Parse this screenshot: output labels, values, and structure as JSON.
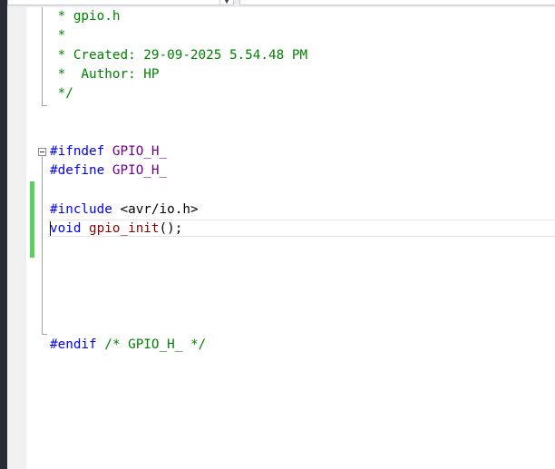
{
  "editor": {
    "header_comment": {
      "l1": " * gpio.h",
      "l2": " *",
      "l3": " * Created: 29-09-2025 5.54.48 PM",
      "l4": " *  Author: HP",
      "l5": " */"
    },
    "ifndef": {
      "directive": "#ifndef",
      "macro": "GPIO_H_"
    },
    "define": {
      "directive": "#define",
      "macro": "GPIO_H_"
    },
    "include": {
      "directive": "#include",
      "path": "<avr/io.h>"
    },
    "declaration": {
      "keyword": "void",
      "name": "gpio_init",
      "rest": "();"
    },
    "endif": {
      "directive": "#endif",
      "comment": "/* GPIO_H_ */"
    }
  },
  "colors": {
    "comment": "#008000",
    "preprocessor": "#0000ff",
    "macro": "#6f008a",
    "keyword": "#0000ff",
    "function": "#880000",
    "change_marker": "#57d35c"
  },
  "icons": {
    "collapse": "minus-box-icon",
    "dropdown": "chevron-down-icon"
  }
}
